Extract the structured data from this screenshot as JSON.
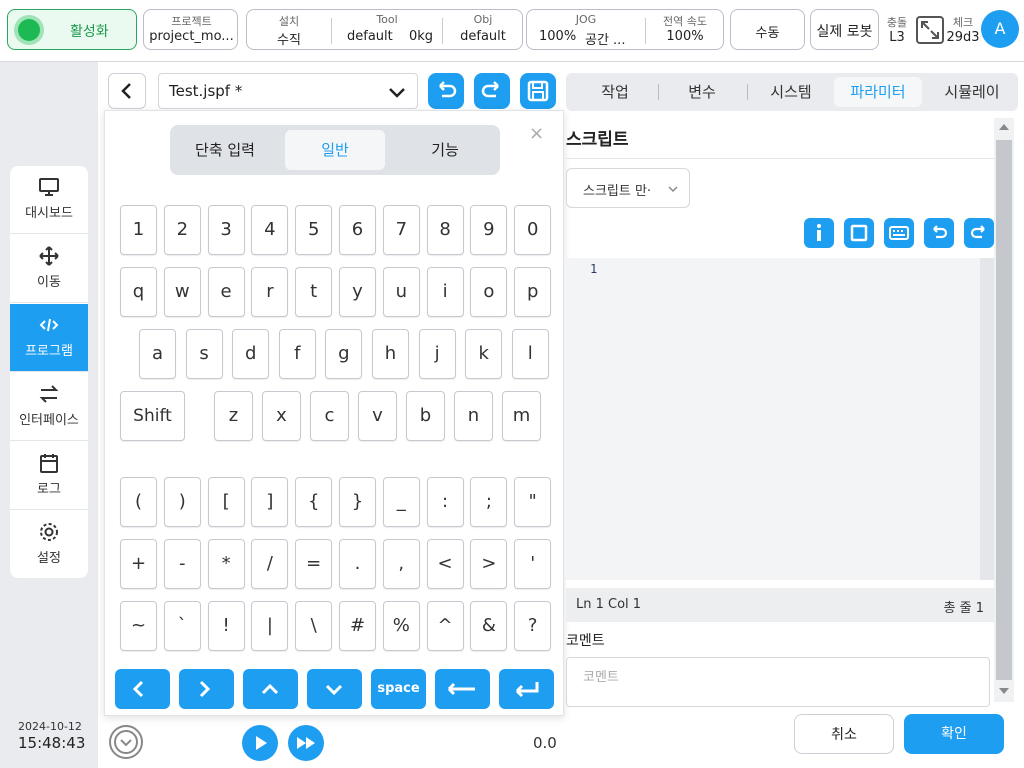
{
  "topbar": {
    "activate_label": "활성화",
    "project": {
      "label": "프로젝트",
      "value": "project_mo..."
    },
    "install": {
      "label": "설치",
      "value": "수직"
    },
    "tool": {
      "label": "Tool",
      "name": "default",
      "weight": "0kg"
    },
    "obj": {
      "label": "Obj",
      "value": "default"
    },
    "jog": {
      "label": "JOG",
      "pct": "100%",
      "space": "공간 ..."
    },
    "global_speed": {
      "label": "전역 속도",
      "value": "100%"
    },
    "manual_label": "수동",
    "real_robot_label": "실제 로봇",
    "collision": {
      "label": "충돌",
      "value": "L3"
    },
    "check": {
      "label": "체크",
      "value": "29d3"
    },
    "avatar_letter": "A"
  },
  "nav": {
    "items": [
      {
        "label": "대시보드",
        "icon": "monitor-icon"
      },
      {
        "label": "이동",
        "icon": "move-icon"
      },
      {
        "label": "프로그램",
        "icon": "code-icon"
      },
      {
        "label": "인터페이스",
        "icon": "swap-icon"
      },
      {
        "label": "로그",
        "icon": "calendar-icon"
      },
      {
        "label": "설정",
        "icon": "gear-icon"
      }
    ]
  },
  "file": {
    "name": "Test.jspf *"
  },
  "keyboard": {
    "tabs": [
      "단축 입력",
      "일반",
      "기능"
    ],
    "active_tab": "일반",
    "row1": [
      "1",
      "2",
      "3",
      "4",
      "5",
      "6",
      "7",
      "8",
      "9",
      "0"
    ],
    "row2": [
      "q",
      "w",
      "e",
      "r",
      "t",
      "y",
      "u",
      "i",
      "o",
      "p"
    ],
    "row3": [
      "a",
      "s",
      "d",
      "f",
      "g",
      "h",
      "j",
      "k",
      "l"
    ],
    "shift_label": "Shift",
    "row4": [
      "z",
      "x",
      "c",
      "v",
      "b",
      "n",
      "m"
    ],
    "row5": [
      "(",
      ")",
      "[",
      "]",
      "{",
      "}",
      "_",
      ":",
      ";",
      "\""
    ],
    "row6": [
      "+",
      "-",
      "*",
      "/",
      "=",
      ".",
      ",",
      "<",
      ">",
      "'"
    ],
    "row7": [
      "~",
      "`",
      "!",
      "|",
      "\\",
      "#",
      "%",
      "^",
      "&",
      "?"
    ],
    "space_label": "space"
  },
  "tabs": [
    "작업",
    "변수",
    "시스템",
    "파라미터",
    "시뮬레이"
  ],
  "active_tab": "파라미터",
  "script": {
    "title": "스크립트",
    "select_value": "스크립트 만·",
    "line_number": "1",
    "status_pos": "Ln 1 Col 1",
    "status_total": "총 줄 1",
    "comment_label": "코멘트",
    "comment_placeholder": "코멘트"
  },
  "footer": {
    "date": "2024-10-12",
    "time": "15:48:43",
    "speed_value": "0.0",
    "cancel_label": "취소",
    "confirm_label": "확인"
  },
  "colors": {
    "accent": "#1e9ef0",
    "active_green": "#1db954"
  }
}
